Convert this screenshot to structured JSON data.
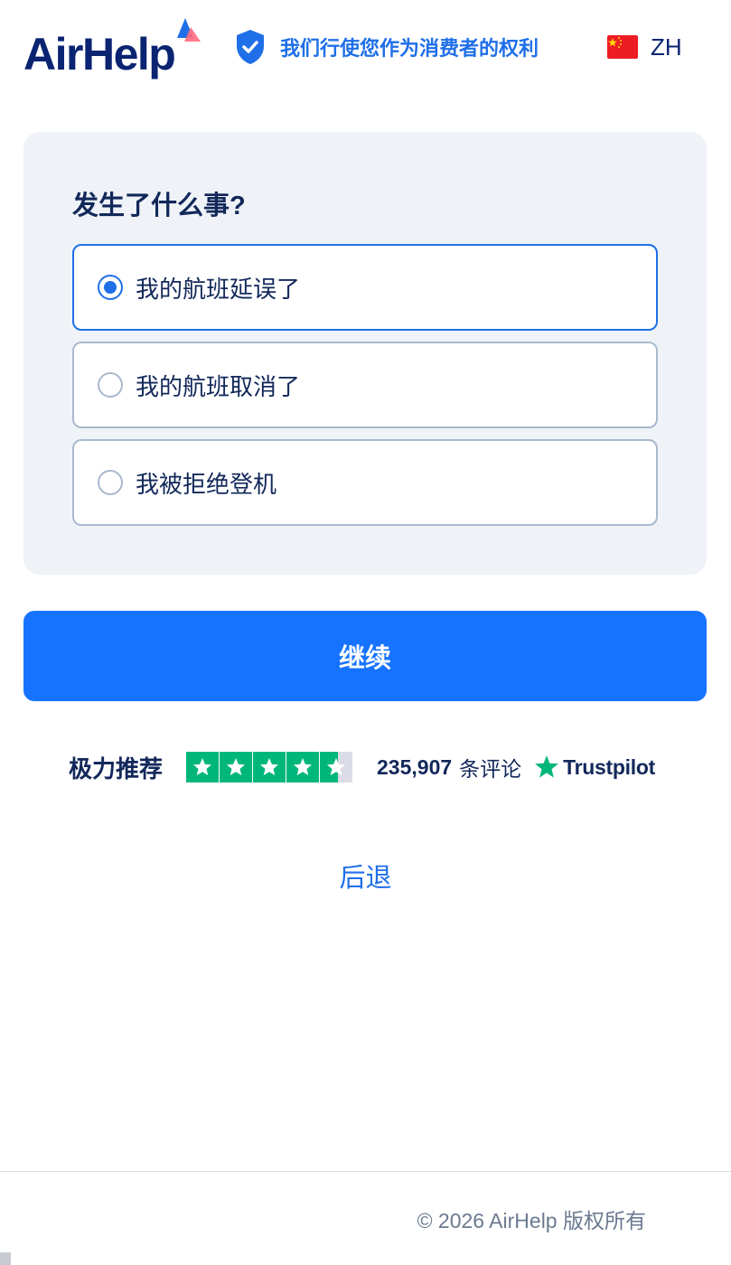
{
  "header": {
    "logo_text": "AirHelp",
    "trust_claim": "我们行使您作为消费者的权利",
    "language_code": "ZH"
  },
  "form": {
    "question": "发生了什么事?",
    "options": [
      {
        "label": "我的航班延误了",
        "selected": true
      },
      {
        "label": "我的航班取消了",
        "selected": false
      },
      {
        "label": "我被拒绝登机",
        "selected": false
      }
    ],
    "continue_label": "继续"
  },
  "trustpilot": {
    "rating_label": "极力推荐",
    "stars": 4.5,
    "review_count": "235,907",
    "review_label": "条评论",
    "brand": "Trustpilot"
  },
  "back_label": "后退",
  "footer": {
    "copyright": "© 2026 AirHelp 版权所有"
  },
  "colors": {
    "brand_blue": "#1673ff",
    "navy": "#12285a",
    "trustpilot_green": "#00b67a"
  }
}
